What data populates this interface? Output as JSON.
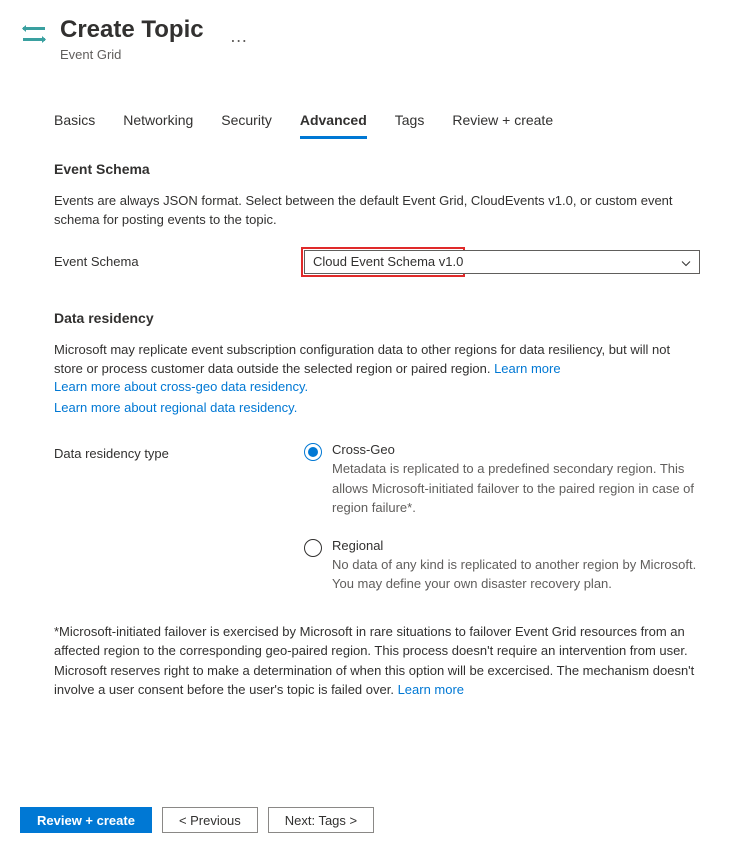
{
  "header": {
    "title": "Create Topic",
    "subtitle": "Event Grid",
    "moreGlyph": "…"
  },
  "tabs": [
    {
      "label": "Basics",
      "active": false
    },
    {
      "label": "Networking",
      "active": false
    },
    {
      "label": "Security",
      "active": false
    },
    {
      "label": "Advanced",
      "active": true
    },
    {
      "label": "Tags",
      "active": false
    },
    {
      "label": "Review + create",
      "active": false
    }
  ],
  "eventSchema": {
    "title": "Event Schema",
    "description": "Events are always JSON format. Select between the default Event Grid, CloudEvents v1.0, or custom event schema for posting events to the topic.",
    "label": "Event Schema",
    "value": "Cloud Event Schema v1.0"
  },
  "dataResidency": {
    "title": "Data residency",
    "descriptionPre": "Microsoft may replicate event subscription configuration data to other regions for data resiliency, but will not store or process customer data outside the selected region or paired region. ",
    "learnMore": "Learn more",
    "link1": "Learn more about cross-geo data residency.",
    "link2": "Learn more about regional data residency.",
    "label": "Data residency type",
    "options": [
      {
        "label": "Cross-Geo",
        "checked": true,
        "desc": "Metadata is replicated to a predefined secondary region. This allows Microsoft-initiated failover to the paired region in case of region failure*."
      },
      {
        "label": "Regional",
        "checked": false,
        "desc": "No data of any kind is replicated to another region by Microsoft. You may define your own disaster recovery plan."
      }
    ],
    "footnotePre": "*Microsoft-initiated failover is exercised by Microsoft in rare situations to failover Event Grid resources from an affected region to the corresponding geo-paired region. This process doesn't require an intervention from user. Microsoft reserves right to make a determination of when this option will be excercised. The mechanism doesn't involve a user consent before the user's topic is failed over. ",
    "footnoteLink": "Learn more"
  },
  "footer": {
    "review": "Review + create",
    "previous": "< Previous",
    "next": "Next: Tags >"
  }
}
